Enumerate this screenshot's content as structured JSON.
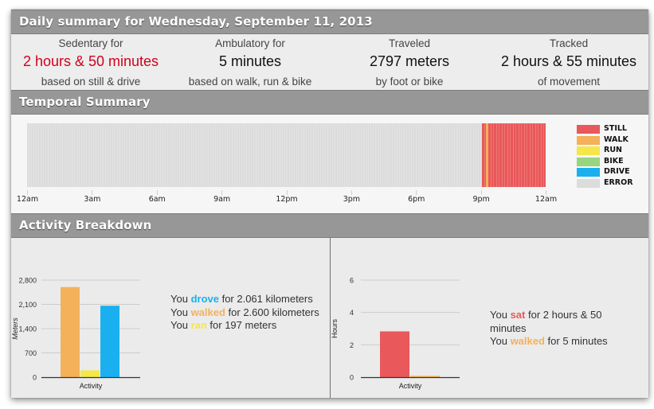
{
  "header": {
    "title": "Daily summary for Wednesday, September 11, 2013"
  },
  "summary": [
    {
      "label": "Sedentary for",
      "value": "2 hours & 50 minutes",
      "sub": "based on still & drive",
      "highlight": true
    },
    {
      "label": "Ambulatory for",
      "value": "5 minutes",
      "sub": "based on walk, run & bike",
      "highlight": false
    },
    {
      "label": "Traveled",
      "value": "2797 meters",
      "sub": "by foot or bike",
      "highlight": false
    },
    {
      "label": "Tracked",
      "value": "2 hours & 55 minutes",
      "sub": "of movement",
      "highlight": false
    }
  ],
  "temporal": {
    "title": "Temporal Summary",
    "ticks": [
      "12am",
      "3am",
      "6am",
      "9am",
      "12pm",
      "3pm",
      "6pm",
      "9pm",
      "12am"
    ],
    "segments": [
      {
        "activity": "ERROR",
        "start_hour": 0,
        "end_hour": 21.05
      },
      {
        "activity": "STILL",
        "start_hour": 21.05,
        "end_hour": 21.25
      },
      {
        "activity": "WALK",
        "start_hour": 21.25,
        "end_hour": 21.33
      },
      {
        "activity": "STILL",
        "start_hour": 21.33,
        "end_hour": 24
      }
    ],
    "legend": [
      {
        "label": "STILL",
        "color": "#e9585a"
      },
      {
        "label": "WALK",
        "color": "#f4b15a"
      },
      {
        "label": "RUN",
        "color": "#f5e64a"
      },
      {
        "label": "BIKE",
        "color": "#97d57e"
      },
      {
        "label": "DRIVE",
        "color": "#1ab0ef"
      },
      {
        "label": "ERROR",
        "color": "#dcdcdc"
      }
    ]
  },
  "activity": {
    "title": "Activity Breakdown",
    "distance_text": [
      {
        "pre": "You ",
        "kw": "drove",
        "color": "#1ab0ef",
        "post": " for 2.061 kilometers"
      },
      {
        "pre": "You ",
        "kw": "walked",
        "color": "#f4b15a",
        "post": " for 2.600 kilometers"
      },
      {
        "pre": "You ",
        "kw": "ran",
        "color": "#f5e64a",
        "post": " for 197 meters"
      }
    ],
    "time_text": [
      {
        "pre": "You ",
        "kw": "sat",
        "color": "#e9585a",
        "post": " for 2 hours & 50 minutes"
      },
      {
        "pre": "You ",
        "kw": "walked",
        "color": "#f4b15a",
        "post": " for 5 minutes"
      }
    ]
  },
  "chart_data": [
    {
      "type": "bar",
      "title": "",
      "xlabel": "Activity",
      "ylabel": "Meters",
      "categories": [
        "Activity"
      ],
      "ylim": [
        0,
        2800
      ],
      "yticks": [
        0,
        700,
        1400,
        2100,
        2800
      ],
      "ytick_labels": [
        "0",
        "700",
        "1,400",
        "2,100",
        "2,800"
      ],
      "grid": true,
      "series": [
        {
          "name": "walk",
          "color": "#f4b15a",
          "values": [
            2600
          ]
        },
        {
          "name": "run",
          "color": "#f5e64a",
          "values": [
            197
          ]
        },
        {
          "name": "drive",
          "color": "#1ab0ef",
          "values": [
            2061
          ]
        }
      ]
    },
    {
      "type": "bar",
      "title": "",
      "xlabel": "Activity",
      "ylabel": "Hours",
      "categories": [
        "Activity"
      ],
      "ylim": [
        0,
        6
      ],
      "yticks": [
        0,
        2,
        4,
        6
      ],
      "ytick_labels": [
        "0",
        "2",
        "4",
        "6"
      ],
      "grid": true,
      "series": [
        {
          "name": "still",
          "color": "#e9585a",
          "values": [
            2.83
          ]
        },
        {
          "name": "walk",
          "color": "#f4b15a",
          "values": [
            0.08
          ]
        }
      ]
    }
  ]
}
